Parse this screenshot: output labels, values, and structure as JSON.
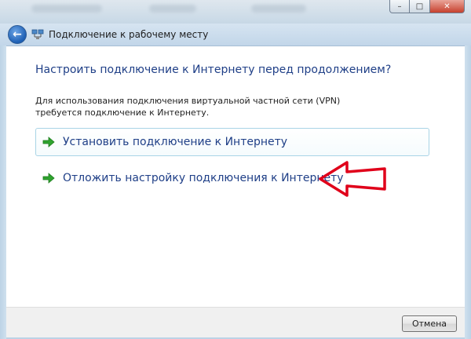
{
  "window": {
    "title": "Подключение к рабочему месту",
    "controls": {
      "minimize": "–",
      "maximize": "□",
      "close": "✕"
    }
  },
  "nav": {
    "back_icon": "back-arrow-icon"
  },
  "content": {
    "heading": "Настроить подключение к Интернету перед продолжением?",
    "description": "Для использования подключения виртуальной частной сети (VPN) требуется подключение к Интернету.",
    "options": [
      {
        "label": "Установить подключение к Интернету",
        "icon": "green-arrow-icon"
      },
      {
        "label": "Отложить настройку подключения к Интернету",
        "icon": "green-arrow-icon"
      }
    ]
  },
  "annotation": {
    "icon": "red-arrow-icon",
    "color": "#e0001a"
  },
  "footer": {
    "cancel_label": "Отмена"
  },
  "colors": {
    "accent_text": "#1f3f87",
    "hover_border": "#a9d4e6",
    "arrow_green": "#2fa32f"
  }
}
